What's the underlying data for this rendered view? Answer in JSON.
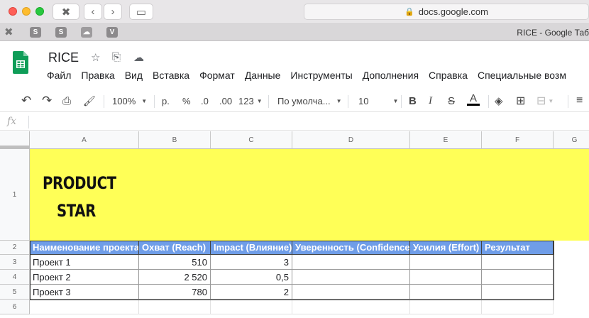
{
  "browser": {
    "url": "docs.google.com",
    "tab_title": "RICE - Google Таб",
    "tab_icons": [
      "S",
      "S",
      "V"
    ]
  },
  "doc": {
    "title": "RICE",
    "menu": [
      "Файл",
      "Правка",
      "Вид",
      "Вставка",
      "Формат",
      "Данные",
      "Инструменты",
      "Дополнения",
      "Справка",
      "Специальные возм"
    ]
  },
  "toolbar": {
    "zoom": "100%",
    "currency": "р.",
    "percent": "%",
    "dec_less": ".0",
    "dec_more": ".00",
    "number_format": "123",
    "font": "По умолча...",
    "font_size": "10",
    "bold": "B",
    "italic": "I",
    "strike": "S",
    "text_color": "A"
  },
  "formula_bar": {
    "label": "fx",
    "value": ""
  },
  "sheet": {
    "columns": [
      "A",
      "B",
      "C",
      "D",
      "E",
      "F",
      "G"
    ],
    "rows": [
      "1",
      "2",
      "3",
      "4",
      "5",
      "6"
    ],
    "logo": {
      "line1": "PRODUCT",
      "line2": "STAR"
    },
    "headers": [
      "Наименование проекта",
      "Охват (Reach)",
      "Impact (Влияние)",
      "Уверенность (Confidence",
      "Усилия (Effort)",
      "Результат"
    ],
    "data": [
      [
        "Проект 1",
        "510",
        "3",
        "",
        "",
        ""
      ],
      [
        "Проект 2",
        "2 520",
        "0,5",
        "",
        "",
        ""
      ],
      [
        "Проект 3",
        "780",
        "2",
        "",
        "",
        ""
      ]
    ],
    "colors": {
      "banner": "#ffff57",
      "header": "#6f9de8"
    }
  }
}
